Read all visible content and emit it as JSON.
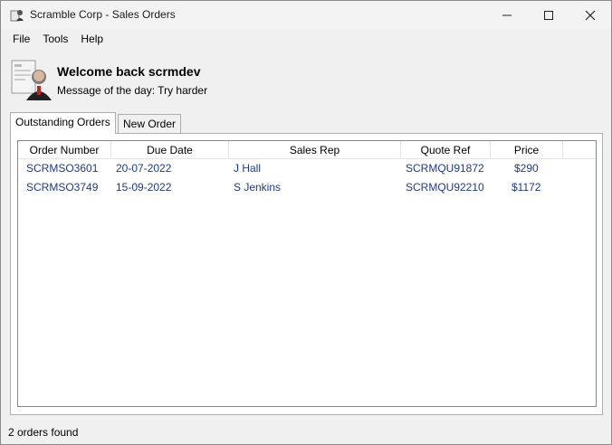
{
  "window": {
    "title": "Scramble Corp - Sales Orders"
  },
  "menu": {
    "file": "File",
    "tools": "Tools",
    "help": "Help"
  },
  "header": {
    "welcome": "Welcome back scrmdev",
    "motd": "Message of the day: Try harder"
  },
  "tabs": [
    {
      "label": "Outstanding Orders",
      "active": true
    },
    {
      "label": "New Order",
      "active": false
    }
  ],
  "table": {
    "columns": [
      "Order Number",
      "Due Date",
      "Sales Rep",
      "Quote Ref",
      "Price"
    ],
    "rows": [
      [
        "SCRMSO3601",
        "20-07-2022",
        "J Hall",
        "SCRMQU91872",
        "$290"
      ],
      [
        "SCRMSO3749",
        "15-09-2022",
        "S Jenkins",
        "SCRMQU92210",
        "$1172"
      ]
    ]
  },
  "status": {
    "text": "2 orders found"
  },
  "colors": {
    "link_text": "#1e3a8a",
    "window_bg": "#f0f0f0"
  },
  "icons": [
    "app-icon",
    "minimize-icon",
    "maximize-icon",
    "close-icon",
    "user-avatar-icon"
  ]
}
